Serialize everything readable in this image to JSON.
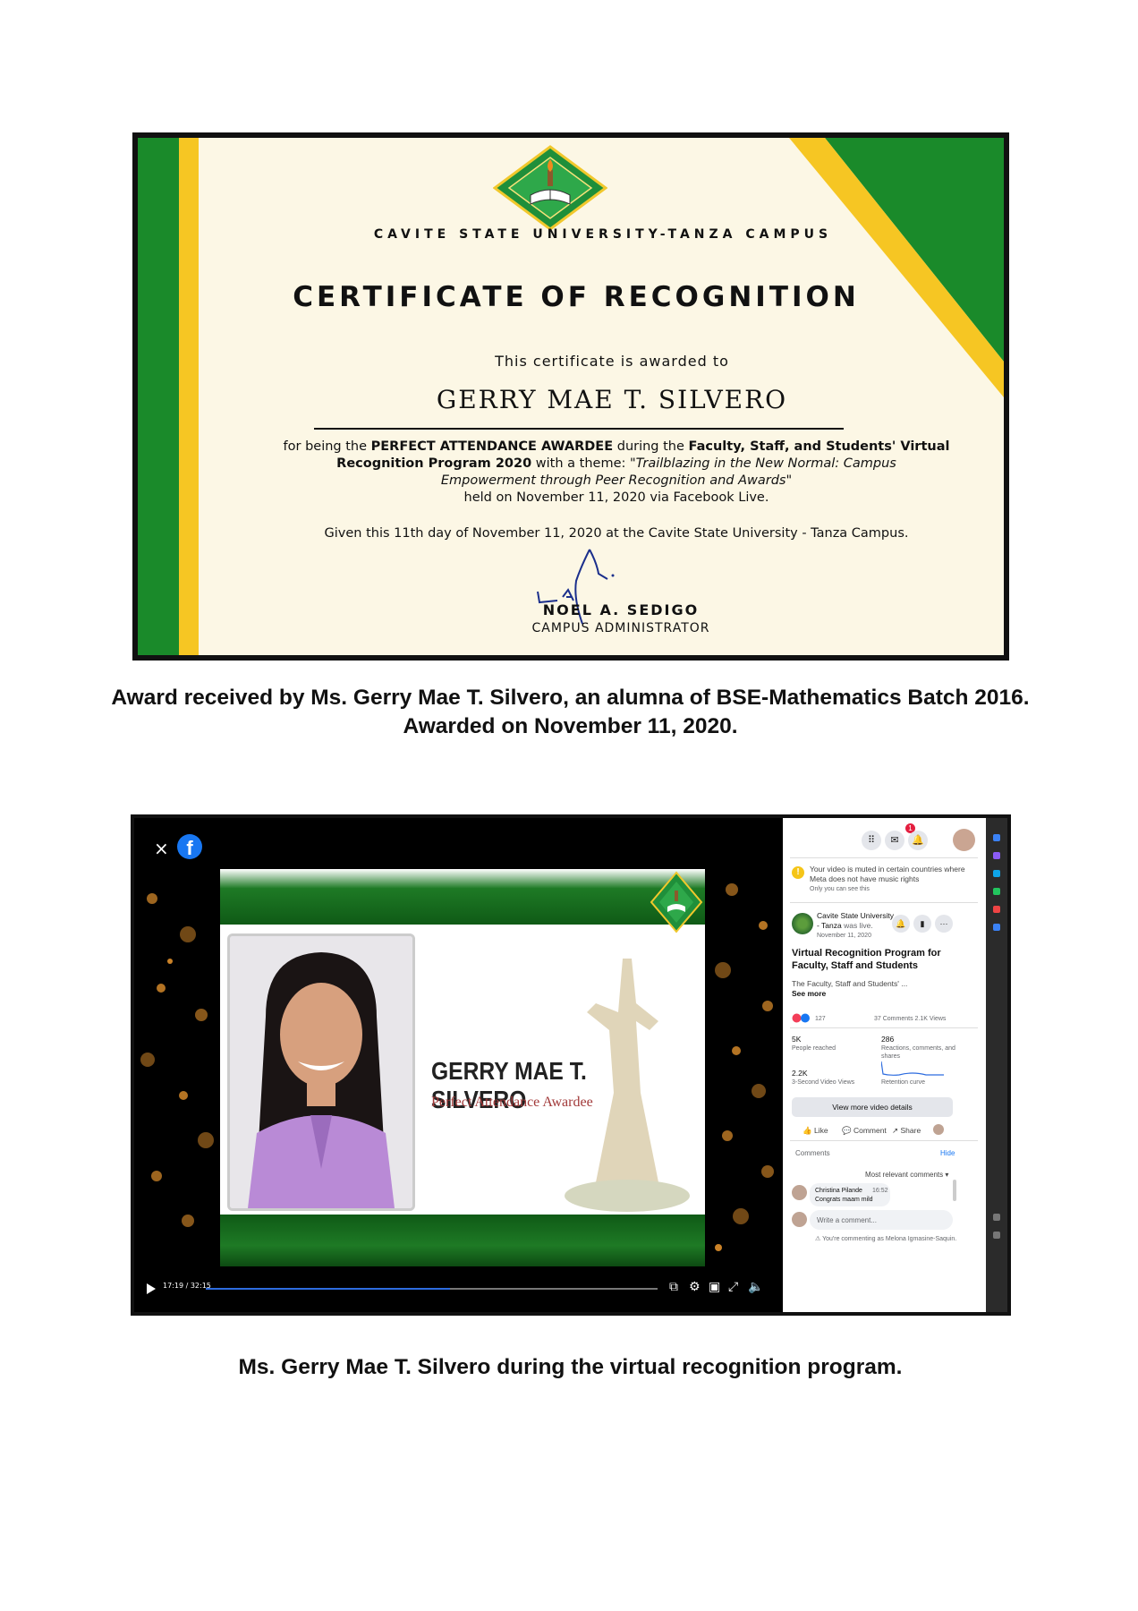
{
  "certificate": {
    "university": "CAVITE STATE UNIVERSITY-TANZA CAMPUS",
    "title": "CERTIFICATE OF RECOGNITION",
    "awarded_to": "This certificate is awarded to",
    "recipient": "GERRY MAE T. SILVERO",
    "citation": {
      "p1": "for being the ",
      "award": "PERFECT ATTENDANCE AWARDEE",
      "p2": " during the ",
      "event_a": "Faculty, Staff, and Students' Virtual",
      "event_b": "Recognition Program 2020",
      "p3": " with a theme: ",
      "theme_a": "\"Trailblazing in the New Normal: Campus",
      "theme_b": "Empowerment through Peer Recognition and Awards\"",
      "held": "held on November 11, 2020 via Facebook Live."
    },
    "given": "Given this 11th day of November 11, 2020 at the Cavite State University - Tanza Campus.",
    "signer": "NOEL A. SEDIGO",
    "signer_role": "CAMPUS ADMINISTRATOR",
    "colors": {
      "green": "#1a8a2a",
      "yellow": "#f6c623",
      "background": "#fcf7e5"
    }
  },
  "caption1": "Award received by Ms. Gerry Mae T. Silvero, an alumna of BSE-Mathematics Batch 2016. Awarded on November 11, 2020.",
  "caption2": "Ms. Gerry Mae T. Silvero during the virtual recognition program.",
  "facebook": {
    "close_icon": "×",
    "logo": "f",
    "slide": {
      "name": "GERRY MAE T. SILVERO",
      "subtitle": "Perfect Attendance Awardee"
    },
    "player": {
      "time": "17:19 / 32:15",
      "progress_fraction": 0.54
    },
    "panel": {
      "notification_count": "1",
      "mute_notice_line1": "Your video is muted in certain countries where",
      "mute_notice_line2": "Meta does not have music rights",
      "mute_notice_line3": "Only you can see this",
      "page_name": "Cavite State University",
      "page_name_line2": "- Tanza",
      "live_text": "was live.",
      "post_date": "November 11, 2020",
      "post_title_line1": "Virtual Recognition Program for",
      "post_title_line2": "Faculty, Staff and Students",
      "post_excerpt": "The Faculty, Staff and Students' ...",
      "see_more": "See more",
      "reactions": "127",
      "comments_views": "37 Comments  2.1K Views",
      "stat1_value": "5K",
      "stat1_label": "People reached",
      "stat2_value": "286",
      "stat2_label_line1": "Reactions, comments, and",
      "stat2_label_line2": "shares",
      "stat3_value": "2.2K",
      "stat3_label": "3-Second Video Views",
      "stat4_label": "Retention curve",
      "view_more": "View more video details",
      "like": "Like",
      "comment": "Comment",
      "share": "Share",
      "comments_header": "Comments",
      "hide": "Hide",
      "sort": "Most relevant comments",
      "commenter": "Christina Pilande",
      "comment_time": "16:52",
      "comment_text": "Congrats maam mild",
      "write_placeholder": "Write a comment...",
      "commenting_as": "You're commenting as Melona Igmasine-Saquin."
    }
  }
}
